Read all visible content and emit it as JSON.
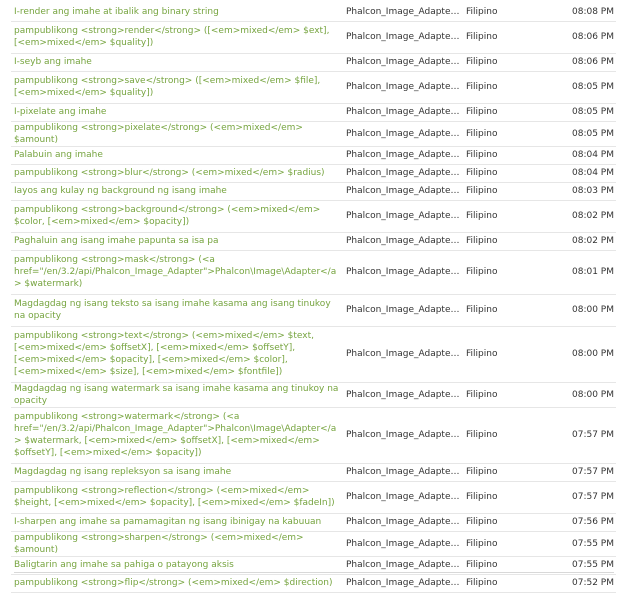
{
  "rows": [
    {
      "text": "I-render ang imahe at ibalik ang binary string",
      "file": "Phalcon_Image_Adapter....",
      "lang": "Filipino",
      "time": "08:08 PM",
      "lines": 1
    },
    {
      "text": "pampublikong <strong>render</strong> ([<em>mixed</em> $ext], [<em>mixed</em> $quality])",
      "file": "Phalcon_Image_Adapter....",
      "lang": "Filipino",
      "time": "08:06 PM",
      "lines": 2
    },
    {
      "text": "I-seyb ang imahe",
      "file": "Phalcon_Image_Adapter....",
      "lang": "Filipino",
      "time": "08:06 PM",
      "lines": 1
    },
    {
      "text": "pampublikong <strong>save</strong> ([<em>mixed</em> $file], [<em>mixed</em> $quality])",
      "file": "Phalcon_Image_Adapter....",
      "lang": "Filipino",
      "time": "08:05 PM",
      "lines": 2
    },
    {
      "text": "I-pixelate ang imahe",
      "file": "Phalcon_Image_Adapter....",
      "lang": "Filipino",
      "time": "08:05 PM",
      "lines": 1
    },
    {
      "text": "pampublikong <strong>pixelate</strong> (<em>mixed</em> $amount)",
      "file": "Phalcon_Image_Adapter....",
      "lang": "Filipino",
      "time": "08:05 PM",
      "lines": 1
    },
    {
      "text": "Palabuin ang imahe",
      "file": "Phalcon_Image_Adapter....",
      "lang": "Filipino",
      "time": "08:04 PM",
      "lines": 1
    },
    {
      "text": "pampublikong <strong>blur</strong> (<em>mixed</em> $radius)",
      "file": "Phalcon_Image_Adapter....",
      "lang": "Filipino",
      "time": "08:04 PM",
      "lines": 1
    },
    {
      "text": "Iayos ang kulay ng background ng isang imahe",
      "file": "Phalcon_Image_Adapter....",
      "lang": "Filipino",
      "time": "08:03 PM",
      "lines": 1
    },
    {
      "text": "pampublikong <strong>background</strong> (<em>mixed</em> $color, [<em>mixed</em> $opacity])",
      "file": "Phalcon_Image_Adapter....",
      "lang": "Filipino",
      "time": "08:02 PM",
      "lines": 2
    },
    {
      "text": "Paghaluin ang isang imahe papunta sa isa pa",
      "file": "Phalcon_Image_Adapter....",
      "lang": "Filipino",
      "time": "08:02 PM",
      "lines": 1
    },
    {
      "text": "pampublikong <strong>mask</strong> (<a href=\"/en/3.2/api/Phalcon_Image_Adapter\">Phalcon\\Image\\Adapter</a> $watermark)",
      "file": "Phalcon_Image_Adapter....",
      "lang": "Filipino",
      "time": "08:01 PM",
      "lines": 3
    },
    {
      "text": "Magdagdag ng isang teksto sa isang imahe kasama ang isang tinukoy na opacity",
      "file": "Phalcon_Image_Adapter....",
      "lang": "Filipino",
      "time": "08:00 PM",
      "lines": 2
    },
    {
      "text": "pampublikong <strong>text</strong> (<em>mixed</em> $text, [<em>mixed</em> $offsetX], [<em>mixed</em> $offsetY], [<em>mixed</em> $opacity], [<em>mixed</em> $color], [<em>mixed</em> $size], [<em>mixed</em> $fontfile])",
      "file": "Phalcon_Image_Adapter....",
      "lang": "Filipino",
      "time": "08:00 PM",
      "lines": 4
    },
    {
      "text": "Magdagdag ng isang watermark sa isang imahe kasama ang tinukoy na opacity",
      "file": "Phalcon_Image_Adapter....",
      "lang": "Filipino",
      "time": "08:00 PM",
      "lines": 1
    },
    {
      "text": "pampublikong <strong>watermark</strong> (<a href=\"/en/3.2/api/Phalcon_Image_Adapter\">Phalcon\\Image\\Adapter</a> $watermark, [<em>mixed</em> $offsetX], [<em>mixed</em> $offsetY], [<em>mixed</em> $opacity])",
      "file": "Phalcon_Image_Adapter....",
      "lang": "Filipino",
      "time": "07:57 PM",
      "lines": 4
    },
    {
      "text": "Magdagdag ng isang repleksyon sa isang imahe",
      "file": "Phalcon_Image_Adapter....",
      "lang": "Filipino",
      "time": "07:57 PM",
      "lines": 1
    },
    {
      "text": "pampublikong <strong>reflection</strong> (<em>mixed</em> $height, [<em>mixed</em> $opacity], [<em>mixed</em> $fadeIn])",
      "file": "Phalcon_Image_Adapter....",
      "lang": "Filipino",
      "time": "07:57 PM",
      "lines": 2
    },
    {
      "text": "I-sharpen ang imahe sa pamamagitan ng isang ibinigay na kabuuan",
      "file": "Phalcon_Image_Adapter....",
      "lang": "Filipino",
      "time": "07:56 PM",
      "lines": 1
    },
    {
      "text": "pampublikong <strong>sharpen</strong> (<em>mixed</em> $amount)",
      "file": "Phalcon_Image_Adapter....",
      "lang": "Filipino",
      "time": "07:55 PM",
      "lines": 1
    },
    {
      "text": "Baligtarin ang imahe sa pahiga o patayong aksis",
      "file": "Phalcon_Image_Adapter....",
      "lang": "Filipino",
      "time": "07:55 PM",
      "lines": 1
    },
    {
      "text": "pampublikong <strong>flip</strong> (<em>mixed</em> $direction)",
      "file": "Phalcon_Image_Adapter....",
      "lang": "Filipino",
      "time": "07:52 PM",
      "lines": 1
    }
  ],
  "colors": {
    "link_green": "#76a43f",
    "text": "#333333",
    "border": "#e6e6e6"
  }
}
